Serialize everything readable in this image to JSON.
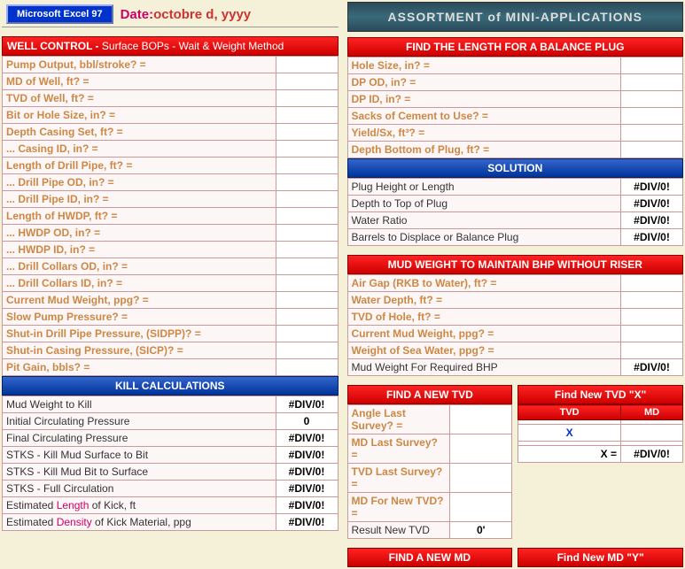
{
  "header": {
    "badge": "Microsoft Excel 97",
    "dateLabel": "Date:",
    "dateValue": "octobre d, yyyy"
  },
  "banner": "ASSORTMENT of MINI-APPLICATIONS",
  "wellControl": {
    "title": "WELL CONTROL -",
    "sub": "Surface BOPs - Wait & Weight Method",
    "rows": [
      "Pump Output, bbl/stroke? =",
      "MD of Well, ft? =",
      "TVD of Well, ft? =",
      "Bit or Hole Size, in? =",
      "Depth Casing Set, ft? =",
      "... Casing ID, in? =",
      "Length of Drill Pipe, ft? =",
      "... Drill Pipe OD, in? =",
      "... Drill Pipe ID, in? =",
      "Length of HWDP, ft? =",
      "... HWDP OD, in? =",
      "... HWDP ID, in? =",
      "... Drill Collars OD, in? =",
      "... Drill Collars ID, in? =",
      "Current Mud Weight, ppg? =",
      "Slow Pump Pressure? =",
      "Shut-in Drill Pipe Pressure, (SIDPP)? =",
      "Shut-in Casing Pressure, (SICP)? =",
      "Pit Gain, bbls? ="
    ]
  },
  "killCalc": {
    "title": "KILL CALCULATIONS",
    "rows": [
      {
        "l": "Mud Weight to Kill",
        "v": "#DIV/0!"
      },
      {
        "l": "Initial Circulating Pressure",
        "v": "0"
      },
      {
        "l": "Final Circulating Pressure",
        "v": "#DIV/0!"
      },
      {
        "l": "STKS - Kill Mud Surface to Bit",
        "v": "#DIV/0!"
      },
      {
        "l": "STKS - Kill Mud Bit to Surface",
        "v": "#DIV/0!"
      },
      {
        "l": "STKS - Full Circulation",
        "v": "#DIV/0!"
      },
      {
        "l": "Estimated Length of Kick, ft",
        "v": "#DIV/0!",
        "hl": "Length"
      },
      {
        "l": "Estimated Density of Kick Material, ppg",
        "v": "#DIV/0!",
        "hl": "Density"
      }
    ]
  },
  "balancePlug": {
    "title": "FIND THE LENGTH FOR A BALANCE PLUG",
    "inputs": [
      "Hole Size, in? =",
      "DP OD, in? =",
      "DP ID, in? =",
      "Sacks of Cement to Use? =",
      "Yield/Sx, ft³? =",
      "Depth Bottom of Plug, ft? ="
    ],
    "solTitle": "SOLUTION",
    "sol": [
      {
        "l": "Plug Height or Length",
        "v": "#DIV/0!"
      },
      {
        "l": "Depth to Top of Plug",
        "v": "#DIV/0!"
      },
      {
        "l": "Water Ratio",
        "v": "#DIV/0!"
      },
      {
        "l": "Barrels to Displace or Balance Plug",
        "v": "#DIV/0!"
      }
    ]
  },
  "mudWeight": {
    "title": "MUD WEIGHT TO MAINTAIN BHP WITHOUT RISER",
    "inputs": [
      "Air Gap (RKB to Water), ft? =",
      "Water Depth, ft? =",
      "TVD of Hole, ft? =",
      "Current Mud Weight, ppg? =",
      "Weight of Sea Water, ppg? ="
    ],
    "result": {
      "l": "Mud Weight For Required BHP",
      "v": "#DIV/0!"
    }
  },
  "newTVD": {
    "title": "FIND A NEW TVD",
    "inputs": [
      "Angle Last Survey? =",
      "MD Last Survey? =",
      "TVD Last Survey? =",
      "MD For New TVD? ="
    ],
    "result": {
      "l": "Result New TVD",
      "v": "0'"
    }
  },
  "tvdX": {
    "title": "Find New TVD \"X\"",
    "h1": "TVD",
    "h2": "MD",
    "x": "X",
    "xeq": "X =",
    "xval": "#DIV/0!"
  },
  "newMD": {
    "title": "FIND A NEW MD"
  },
  "mdY": {
    "title": "Find New MD \"Y\""
  }
}
